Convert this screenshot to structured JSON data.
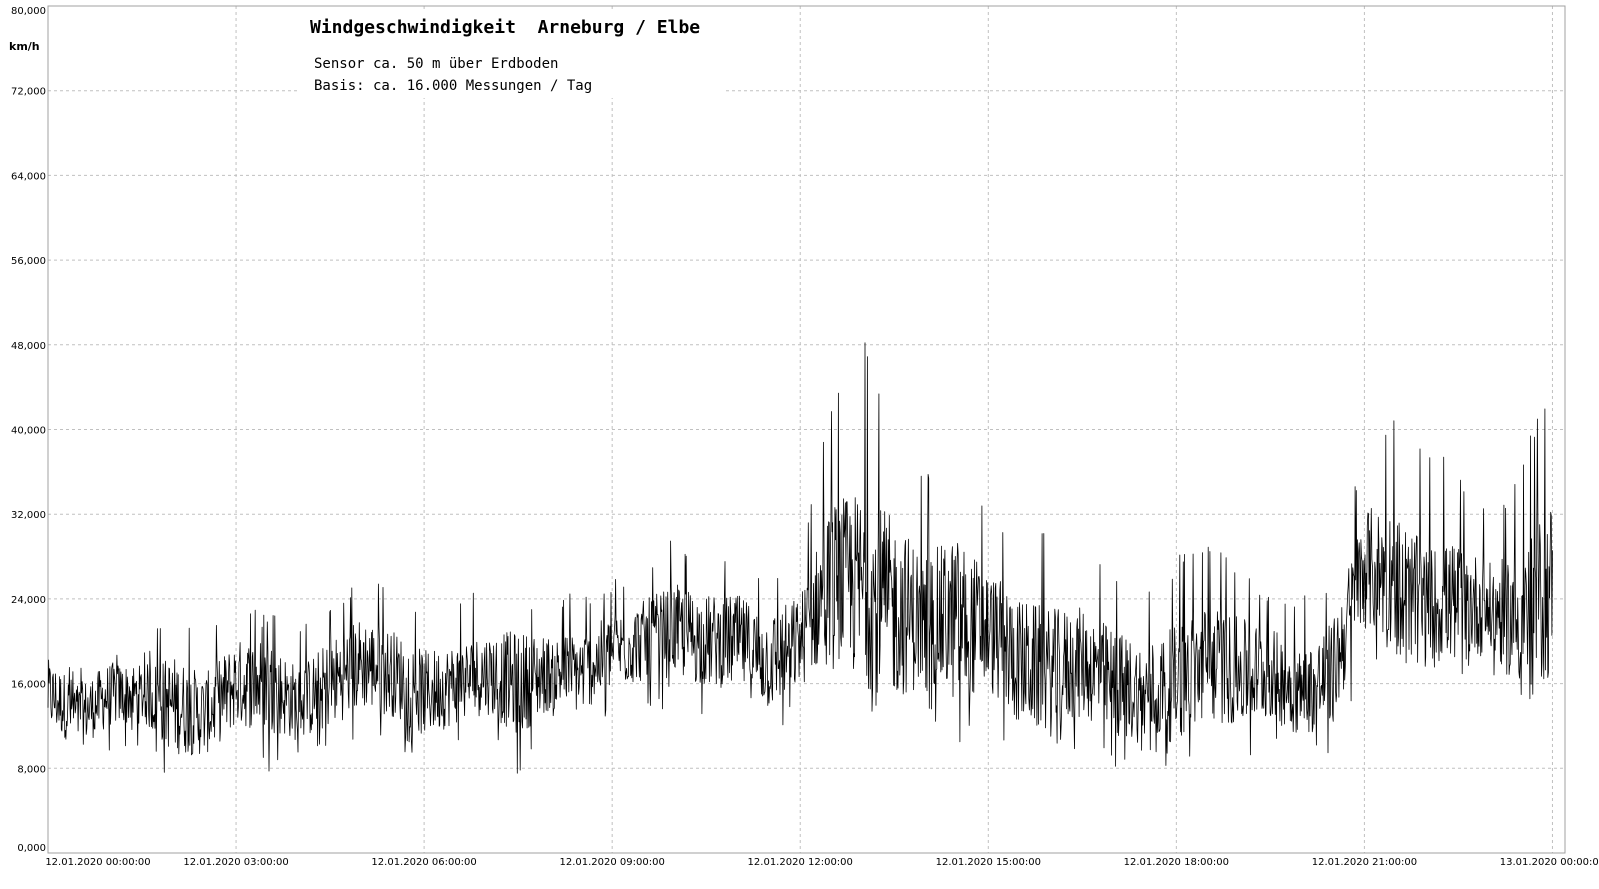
{
  "chart_data": {
    "type": "line",
    "title": "Windgeschwindigkeit  Arneburg / Elbe",
    "subtitle_lines": [
      "Sensor ca. 50 m über Erdboden",
      "Basis: ca. 16.000 Messungen / Tag"
    ],
    "ylabel": "km/h",
    "xlabel": "",
    "ylim": [
      0,
      80
    ],
    "yticks": [
      {
        "value": 0,
        "label": "0,000"
      },
      {
        "value": 8,
        "label": "8,000"
      },
      {
        "value": 16,
        "label": "16,000"
      },
      {
        "value": 24,
        "label": "24,000"
      },
      {
        "value": 32,
        "label": "32,000"
      },
      {
        "value": 40,
        "label": "40,000"
      },
      {
        "value": 48,
        "label": "48,000"
      },
      {
        "value": 56,
        "label": "56,000"
      },
      {
        "value": 64,
        "label": "64,000"
      },
      {
        "value": 72,
        "label": "72,000"
      },
      {
        "value": 80,
        "label": "80,000"
      }
    ],
    "xlim_hours": [
      0,
      24.2
    ],
    "xticks": [
      {
        "hours": 0,
        "label": "12.01.2020  00:00:00"
      },
      {
        "hours": 3,
        "label": "12.01.2020  03:00:00"
      },
      {
        "hours": 6,
        "label": "12.01.2020  06:00:00"
      },
      {
        "hours": 9,
        "label": "12.01.2020  09:00:00"
      },
      {
        "hours": 12,
        "label": "12.01.2020  12:00:00"
      },
      {
        "hours": 15,
        "label": "12.01.2020  15:00:00"
      },
      {
        "hours": 18,
        "label": "12.01.2020  18:00:00"
      },
      {
        "hours": 21,
        "label": "12.01.2020  21:00:00"
      },
      {
        "hours": 24,
        "label": "13.01.2020  00:00:00"
      }
    ],
    "grid": true,
    "line_color": "#000000",
    "series": [
      {
        "x_hours": [
          0,
          0.5,
          1,
          1.5,
          2,
          2.5,
          3,
          3.5,
          4,
          4.5,
          5,
          5.5,
          6,
          6.5,
          7,
          7.5,
          8,
          8.5,
          9,
          9.5,
          10,
          10.5,
          11,
          11.5,
          12,
          12.5,
          13,
          13.5,
          14,
          14.5,
          15,
          15.5,
          16,
          16.5,
          17,
          17.5,
          18,
          18.5,
          19,
          19.5,
          20,
          20.5,
          21,
          21.5,
          22,
          22.5,
          23,
          23.5,
          24
        ],
        "mean": [
          15,
          13,
          15,
          15,
          14,
          13,
          16,
          16,
          14,
          16,
          18,
          17,
          15,
          16,
          17,
          16,
          17,
          17,
          19,
          20,
          21,
          20,
          20,
          18,
          20,
          26,
          25,
          23,
          22,
          22,
          21,
          18,
          17,
          18,
          16,
          15,
          16,
          18,
          17,
          17,
          15,
          17,
          27,
          26,
          23,
          24,
          23,
          22,
          25
        ],
        "low": [
          8,
          7,
          9,
          10,
          6,
          7,
          9,
          7,
          8,
          9,
          11,
          11,
          7,
          10,
          11,
          6,
          11,
          11,
          13,
          13,
          14,
          13,
          13,
          10,
          13,
          17,
          15,
          9,
          14,
          9,
          12,
          8,
          9,
          10,
          8,
          8,
          8,
          10,
          8,
          9,
          9,
          9,
          17,
          18,
          17,
          17,
          16,
          14,
          14
        ],
        "high": [
          20,
          18,
          20,
          20,
          23,
          21,
          24,
          23,
          21,
          24,
          27,
          26,
          22,
          24,
          25,
          24,
          24,
          25,
          26,
          27,
          30,
          29,
          29,
          27,
          29,
          43,
          49,
          40,
          37,
          38,
          33,
          30,
          31,
          29,
          27,
          25,
          28,
          30,
          27,
          25,
          24,
          27,
          38,
          41,
          38,
          37,
          32,
          37,
          46
        ]
      }
    ]
  }
}
